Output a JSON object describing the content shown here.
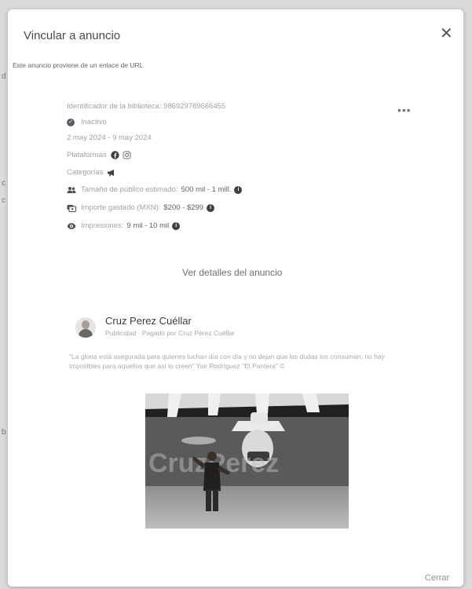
{
  "modal": {
    "title": "Vincular a anuncio",
    "close_glyph": "✕",
    "subtitle": "Este anuncio proviene de un enlace de URL",
    "close_button_label": "Cerrar"
  },
  "ad_info": {
    "library_id": "Identificador de la biblioteca: 986929789666455",
    "status": "Inactivo",
    "date_range": "2 may 2024 - 9 may 2024",
    "platforms_label": "Plataformas",
    "categories_label": "Categorías",
    "audience": {
      "label": "Tamaño de público estimado:",
      "value": "500 mil - 1 mill."
    },
    "spend": {
      "label": "Importe gastado (MXN):",
      "value": "$200 - $299"
    },
    "impressions": {
      "label": "Impresiones:",
      "value": "9 mil - 10 mil"
    },
    "more_glyph": "•••",
    "details_link": "Ver detalles del anuncio"
  },
  "advertiser": {
    "name": "Cruz Perez Cuéllar",
    "subline": "Publicidad · Pagado por Cruz Pérez Cuéllar"
  },
  "ad_body": "\"La gloria está asegurada para quienes luchan día con día y no dejan que las dudas los consuman, no hay imposibles para aquellos que así lo creen\" Yair Rodríguez \"El Pantera\" ©",
  "ad_image_text": "CruzPerez",
  "background_letters": [
    "d",
    "c",
    "c",
    "b"
  ],
  "colors": {
    "modal_bg": "#ffffff",
    "overlay": "#d9dbdc",
    "muted_text": "#9ea3a7"
  }
}
